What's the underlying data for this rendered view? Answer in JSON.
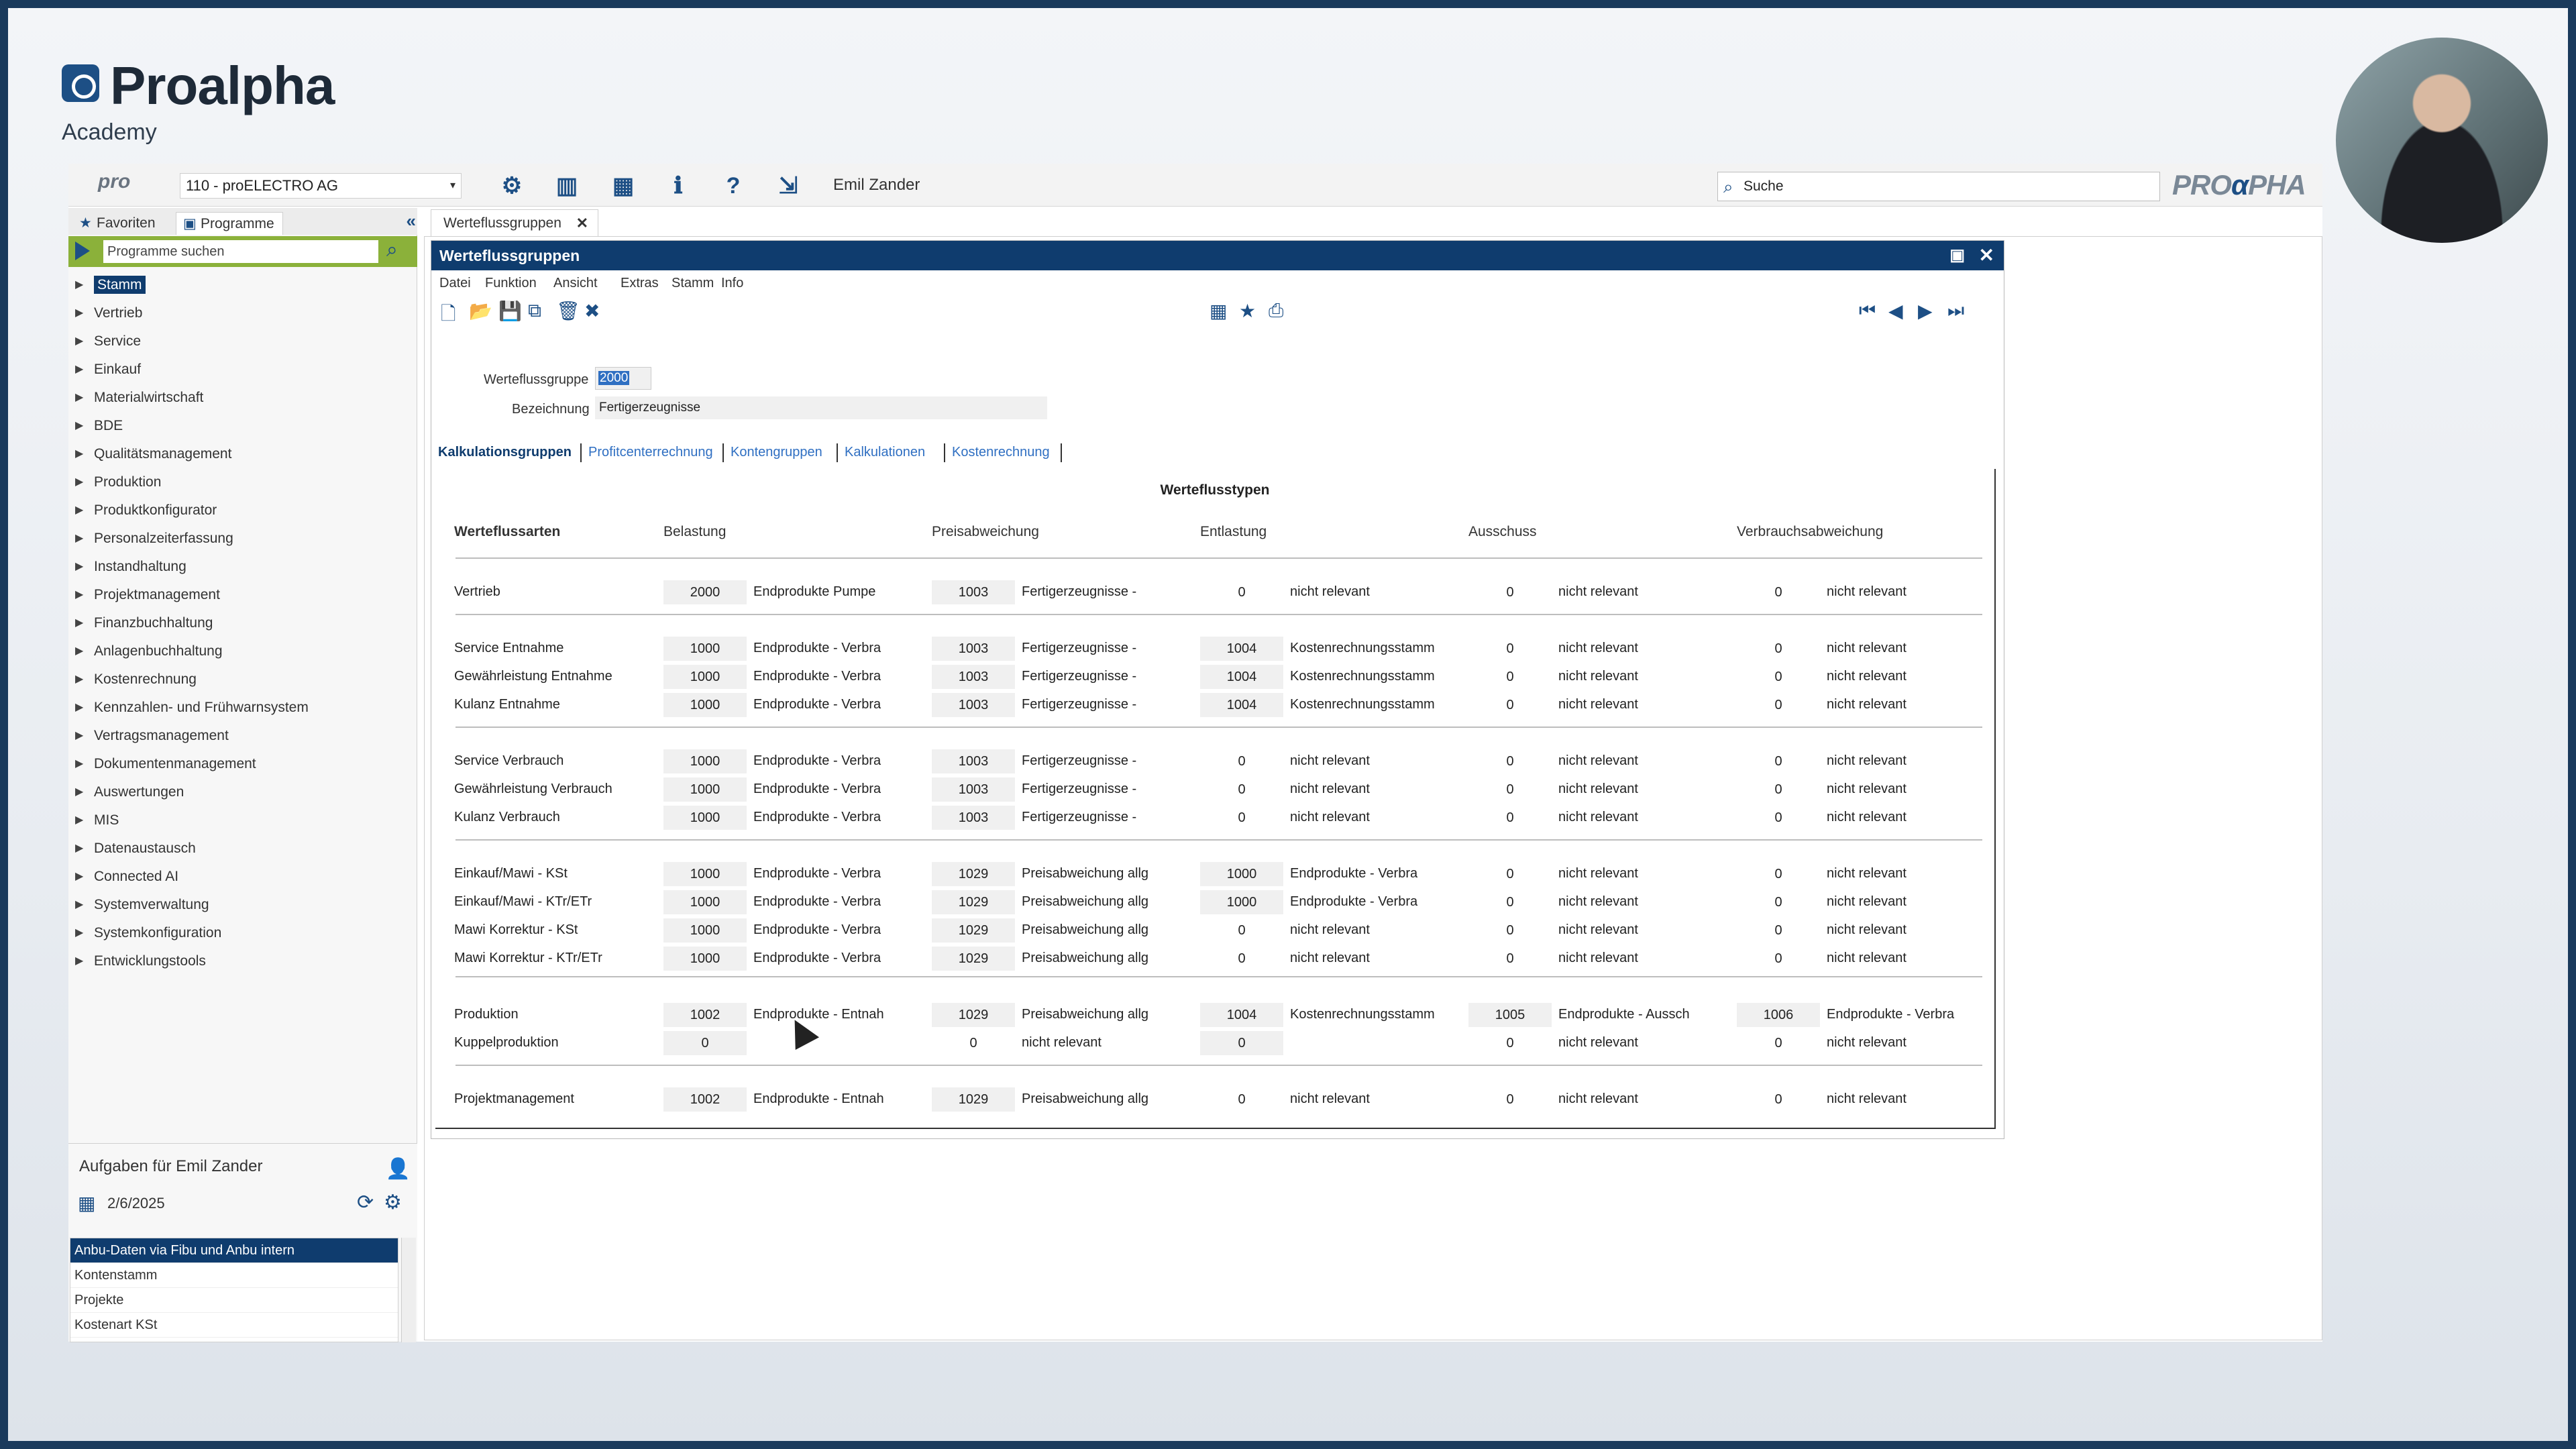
{
  "brand": {
    "name": "Proalpha",
    "subtitle": "Academy"
  },
  "topbar": {
    "pro_label": "pro",
    "company": "110 - proELECTRO AG",
    "user": "Emil Zander",
    "search_placeholder": "Suche",
    "logo_left": "PRO",
    "logo_mid": "α",
    "logo_right": "PHA"
  },
  "left_panel": {
    "tabs": [
      "Favoriten",
      "Programme"
    ],
    "program_search_placeholder": "Programme suchen",
    "tree": [
      "Stamm",
      "Vertrieb",
      "Service",
      "Einkauf",
      "Materialwirtschaft",
      "BDE",
      "Qualitätsmanagement",
      "Produktion",
      "Produktkonfigurator",
      "Personalzeiterfassung",
      "Instandhaltung",
      "Projektmanagement",
      "Finanzbuchhaltung",
      "Anlagenbuchhaltung",
      "Kostenrechnung",
      "Kennzahlen- und Frühwarnsystem",
      "Vertragsmanagement",
      "Dokumentenmanagement",
      "Auswertungen",
      "MIS",
      "Datenaustausch",
      "Connected AI",
      "Systemverwaltung",
      "Systemkonfiguration",
      "Entwicklungstools"
    ],
    "tasks_title": "Aufgaben für Emil Zander",
    "tasks_date": "2/6/2025",
    "tasks": [
      "Anbu-Daten via Fibu und Anbu intern",
      "Kontenstamm",
      "Projekte",
      "Kostenart KSt"
    ]
  },
  "doc_tab": "Werteflussgruppen",
  "window": {
    "title": "Werteflussgruppen",
    "menu": [
      "Datei",
      "Funktion",
      "Ansicht",
      "Extras",
      "Stamm",
      "Info"
    ],
    "group_label": "Werteflussgruppe",
    "group_value": "2000",
    "desc_label": "Bezeichnung",
    "desc_value": "Fertigerzeugnisse",
    "tabs": [
      "Kalkulationsgruppen",
      "Profitcenterrechnung",
      "Kontengruppen",
      "Kalkulationen",
      "Kostenrechnung"
    ],
    "grid_title": "Werteflusstypen",
    "headers": [
      "Werteflussarten",
      "Belastung",
      "Preisabweichung",
      "Entlastung",
      "Ausschuss",
      "Verbrauchsabweichung"
    ],
    "rows": [
      {
        "name": "Vertrieb",
        "c1": "2000",
        "t1": "Endprodukte Pumpe",
        "c2": "1003",
        "t2": "Fertigerzeugnisse -",
        "c3": "0",
        "t3": "nicht relevant",
        "c4": "0",
        "t4": "nicht relevant",
        "c5": "0",
        "t5": "nicht relevant"
      },
      {
        "name": "Service Entnahme",
        "c1": "1000",
        "t1": "Endprodukte - Verbra",
        "c2": "1003",
        "t2": "Fertigerzeugnisse -",
        "c3": "1004",
        "t3": "Kostenrechnungsstamm",
        "c4": "0",
        "t4": "nicht relevant",
        "c5": "0",
        "t5": "nicht relevant"
      },
      {
        "name": "Gewährleistung Entnahme",
        "c1": "1000",
        "t1": "Endprodukte - Verbra",
        "c2": "1003",
        "t2": "Fertigerzeugnisse -",
        "c3": "1004",
        "t3": "Kostenrechnungsstamm",
        "c4": "0",
        "t4": "nicht relevant",
        "c5": "0",
        "t5": "nicht relevant"
      },
      {
        "name": "Kulanz Entnahme",
        "c1": "1000",
        "t1": "Endprodukte - Verbra",
        "c2": "1003",
        "t2": "Fertigerzeugnisse -",
        "c3": "1004",
        "t3": "Kostenrechnungsstamm",
        "c4": "0",
        "t4": "nicht relevant",
        "c5": "0",
        "t5": "nicht relevant"
      },
      {
        "name": "Service Verbrauch",
        "c1": "1000",
        "t1": "Endprodukte - Verbra",
        "c2": "1003",
        "t2": "Fertigerzeugnisse -",
        "c3": "0",
        "t3": "nicht relevant",
        "c4": "0",
        "t4": "nicht relevant",
        "c5": "0",
        "t5": "nicht relevant"
      },
      {
        "name": "Gewährleistung Verbrauch",
        "c1": "1000",
        "t1": "Endprodukte - Verbra",
        "c2": "1003",
        "t2": "Fertigerzeugnisse -",
        "c3": "0",
        "t3": "nicht relevant",
        "c4": "0",
        "t4": "nicht relevant",
        "c5": "0",
        "t5": "nicht relevant"
      },
      {
        "name": "Kulanz Verbrauch",
        "c1": "1000",
        "t1": "Endprodukte - Verbra",
        "c2": "1003",
        "t2": "Fertigerzeugnisse -",
        "c3": "0",
        "t3": "nicht relevant",
        "c4": "0",
        "t4": "nicht relevant",
        "c5": "0",
        "t5": "nicht relevant"
      },
      {
        "name": "Einkauf/Mawi - KSt",
        "c1": "1000",
        "t1": "Endprodukte - Verbra",
        "c2": "1029",
        "t2": "Preisabweichung allg",
        "c3": "1000",
        "t3": "Endprodukte - Verbra",
        "c4": "0",
        "t4": "nicht relevant",
        "c5": "0",
        "t5": "nicht relevant"
      },
      {
        "name": "Einkauf/Mawi - KTr/ETr",
        "c1": "1000",
        "t1": "Endprodukte - Verbra",
        "c2": "1029",
        "t2": "Preisabweichung allg",
        "c3": "1000",
        "t3": "Endprodukte - Verbra",
        "c4": "0",
        "t4": "nicht relevant",
        "c5": "0",
        "t5": "nicht relevant"
      },
      {
        "name": "Mawi Korrektur - KSt",
        "c1": "1000",
        "t1": "Endprodukte - Verbra",
        "c2": "1029",
        "t2": "Preisabweichung allg",
        "c3": "0",
        "t3": "nicht relevant",
        "c4": "0",
        "t4": "nicht relevant",
        "c5": "0",
        "t5": "nicht relevant"
      },
      {
        "name": "Mawi Korrektur - KTr/ETr",
        "c1": "1000",
        "t1": "Endprodukte - Verbra",
        "c2": "1029",
        "t2": "Preisabweichung allg",
        "c3": "0",
        "t3": "nicht relevant",
        "c4": "0",
        "t4": "nicht relevant",
        "c5": "0",
        "t5": "nicht relevant"
      },
      {
        "name": "Produktion",
        "c1": "1002",
        "t1": "Endprodukte - Entnah",
        "c2": "1029",
        "t2": "Preisabweichung allg",
        "c3": "1004",
        "t3": "Kostenrechnungsstamm",
        "c4": "1005",
        "t4": "Endprodukte - Aussch",
        "c5": "1006",
        "t5": "Endprodukte - Verbra"
      },
      {
        "name": "Kuppelproduktion",
        "c1": "0",
        "t1": "",
        "c2": "0",
        "t2": "nicht relevant",
        "c3": "0",
        "t3": "",
        "c4": "0",
        "t4": "nicht relevant",
        "c5": "0",
        "t5": "nicht relevant"
      },
      {
        "name": "Projektmanagement",
        "c1": "1002",
        "t1": "Endprodukte - Entnah",
        "c2": "1029",
        "t2": "Preisabweichung allg",
        "c3": "0",
        "t3": "nicht relevant",
        "c4": "0",
        "t4": "nicht relevant",
        "c5": "0",
        "t5": "nicht relevant"
      }
    ]
  },
  "icons": [
    "gear-icon",
    "columns-icon",
    "layout-icon",
    "info-icon",
    "help-icon",
    "logout-icon",
    "search-icon",
    "star-icon",
    "calendar-icon",
    "print-icon",
    "first-icon",
    "prev-icon",
    "next-icon",
    "last-icon"
  ],
  "colors": {
    "accent": "#0f3c6e",
    "green_bar": "#8bb13a",
    "link": "#2f6fc2"
  }
}
